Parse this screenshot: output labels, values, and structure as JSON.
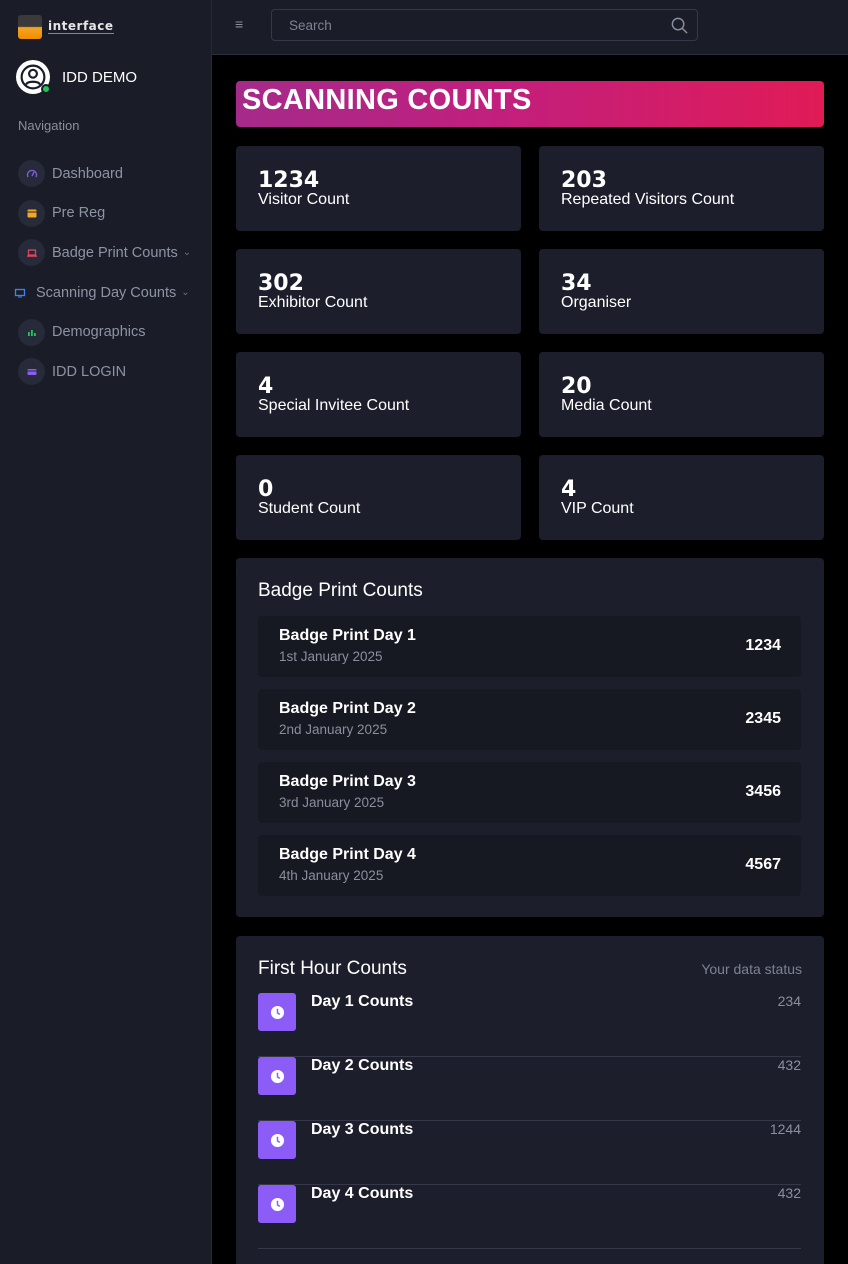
{
  "brand": {
    "logo_text": "interface"
  },
  "user": {
    "name": "IDD DEMO"
  },
  "navigation": {
    "heading": "Navigation",
    "items": [
      {
        "label": "Dashboard",
        "icon": "gauge-icon",
        "color": "#7c5cd6"
      },
      {
        "label": "Pre Reg",
        "icon": "calendar-icon",
        "color": "#f5a623"
      },
      {
        "label": "Badge Print Counts",
        "icon": "laptop-icon",
        "color": "#e0445c",
        "has_chevron": true
      },
      {
        "label": "Scanning Day Counts",
        "icon": "monitor-icon",
        "color": "#3b82f6",
        "has_chevron": true
      },
      {
        "label": "Demographics",
        "icon": "bar-chart-icon",
        "color": "#22c55e"
      },
      {
        "label": "IDD LOGIN",
        "icon": "login-card-icon",
        "color": "#8b5cf6"
      }
    ]
  },
  "search": {
    "placeholder": "Search"
  },
  "banner": {
    "title": "SCANNING COUNTS"
  },
  "stats": [
    {
      "value": "1234",
      "label": "Visitor Count"
    },
    {
      "value": "203",
      "label": "Repeated Visitors Count"
    },
    {
      "value": "302",
      "label": "Exhibitor Count"
    },
    {
      "value": "34",
      "label": "Organiser"
    },
    {
      "value": "4",
      "label": "Special Invitee Count"
    },
    {
      "value": "20",
      "label": "Media Count"
    },
    {
      "value": "0",
      "label": "Student Count"
    },
    {
      "value": "4",
      "label": "VIP Count"
    }
  ],
  "badge_print": {
    "title": "Badge Print Counts",
    "rows": [
      {
        "name": "Badge Print Day 1",
        "date": "1st January 2025",
        "value": "1234"
      },
      {
        "name": "Badge Print Day 2",
        "date": "2nd January 2025",
        "value": "2345"
      },
      {
        "name": "Badge Print Day 3",
        "date": "3rd January 2025",
        "value": "3456"
      },
      {
        "name": "Badge Print Day 4",
        "date": "4th January 2025",
        "value": "4567"
      }
    ]
  },
  "first_hour": {
    "title": "First Hour Counts",
    "status_label": "Your data status",
    "rows": [
      {
        "name": "Day 1 Counts",
        "value": "234"
      },
      {
        "name": "Day 2 Counts",
        "value": "432"
      },
      {
        "name": "Day 3 Counts",
        "value": "1244"
      },
      {
        "name": "Day 4 Counts",
        "value": "432"
      }
    ]
  }
}
